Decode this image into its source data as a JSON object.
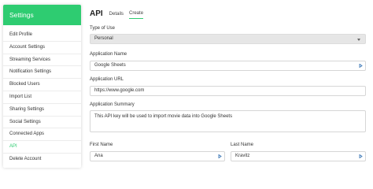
{
  "sidebar": {
    "title": "Settings",
    "items": [
      {
        "label": "Edit Profile"
      },
      {
        "label": "Account Settings"
      },
      {
        "label": "Streaming Services"
      },
      {
        "label": "Notification Settings"
      },
      {
        "label": "Blocked Users"
      },
      {
        "label": "Import List"
      },
      {
        "label": "Sharing Settings"
      },
      {
        "label": "Social Settings"
      },
      {
        "label": "Connected Apps"
      },
      {
        "label": "API"
      },
      {
        "label": "Delete Account"
      }
    ],
    "active_index": 9
  },
  "header": {
    "title": "API",
    "tabs": [
      {
        "label": "Details"
      },
      {
        "label": "Create"
      }
    ]
  },
  "form": {
    "type_of_use": {
      "label": "Type of Use",
      "value": "Personal"
    },
    "application_name": {
      "label": "Application Name",
      "value": "Google Sheets"
    },
    "application_url": {
      "label": "Application URL",
      "value": "https://www.google.com"
    },
    "application_summary": {
      "label": "Application Summary",
      "value": "This API key will be used to import movie data into Google Sheets"
    },
    "first_name": {
      "label": "First Name",
      "value": "Ana"
    },
    "last_name": {
      "label": "Last Name",
      "value": "Kravitz"
    }
  },
  "colors": {
    "accent": "#2ecc71",
    "select_bg": "#e6e6e6"
  },
  "icons": {
    "field_helper": "autofill-arrow-icon",
    "select": "chevron-down-icon"
  }
}
